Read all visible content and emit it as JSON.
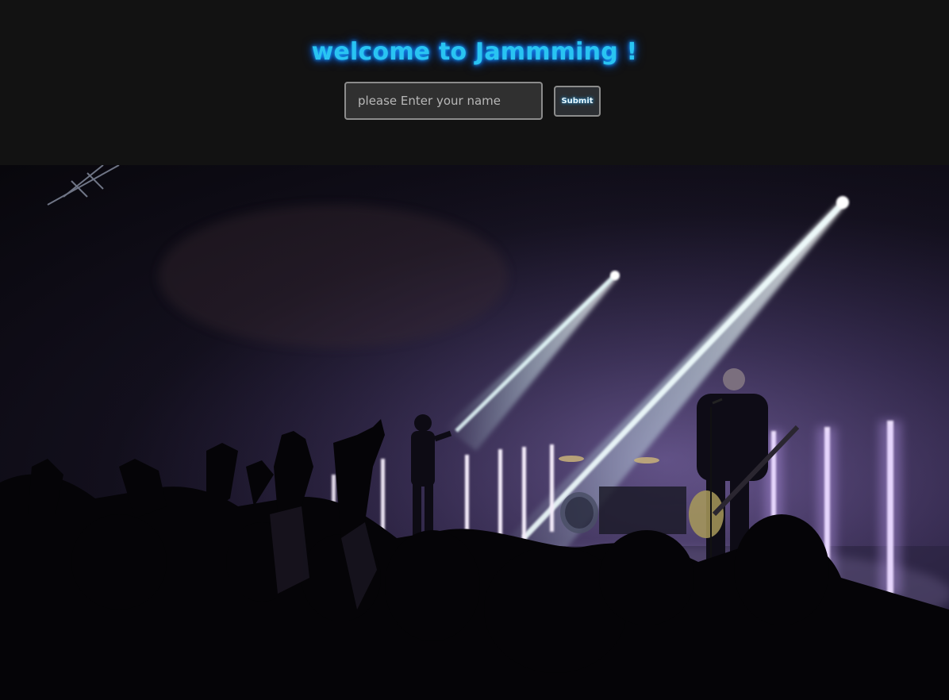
{
  "header": {
    "title": "welcome to Jammming !",
    "name_input": {
      "placeholder": "please Enter your name",
      "value": ""
    },
    "submit_label": "Submit"
  },
  "hero": {
    "image_alt": "concert stage photo with band and cheering crowd"
  },
  "colors": {
    "background": "#121212",
    "title_glow": "#29c4f2"
  }
}
